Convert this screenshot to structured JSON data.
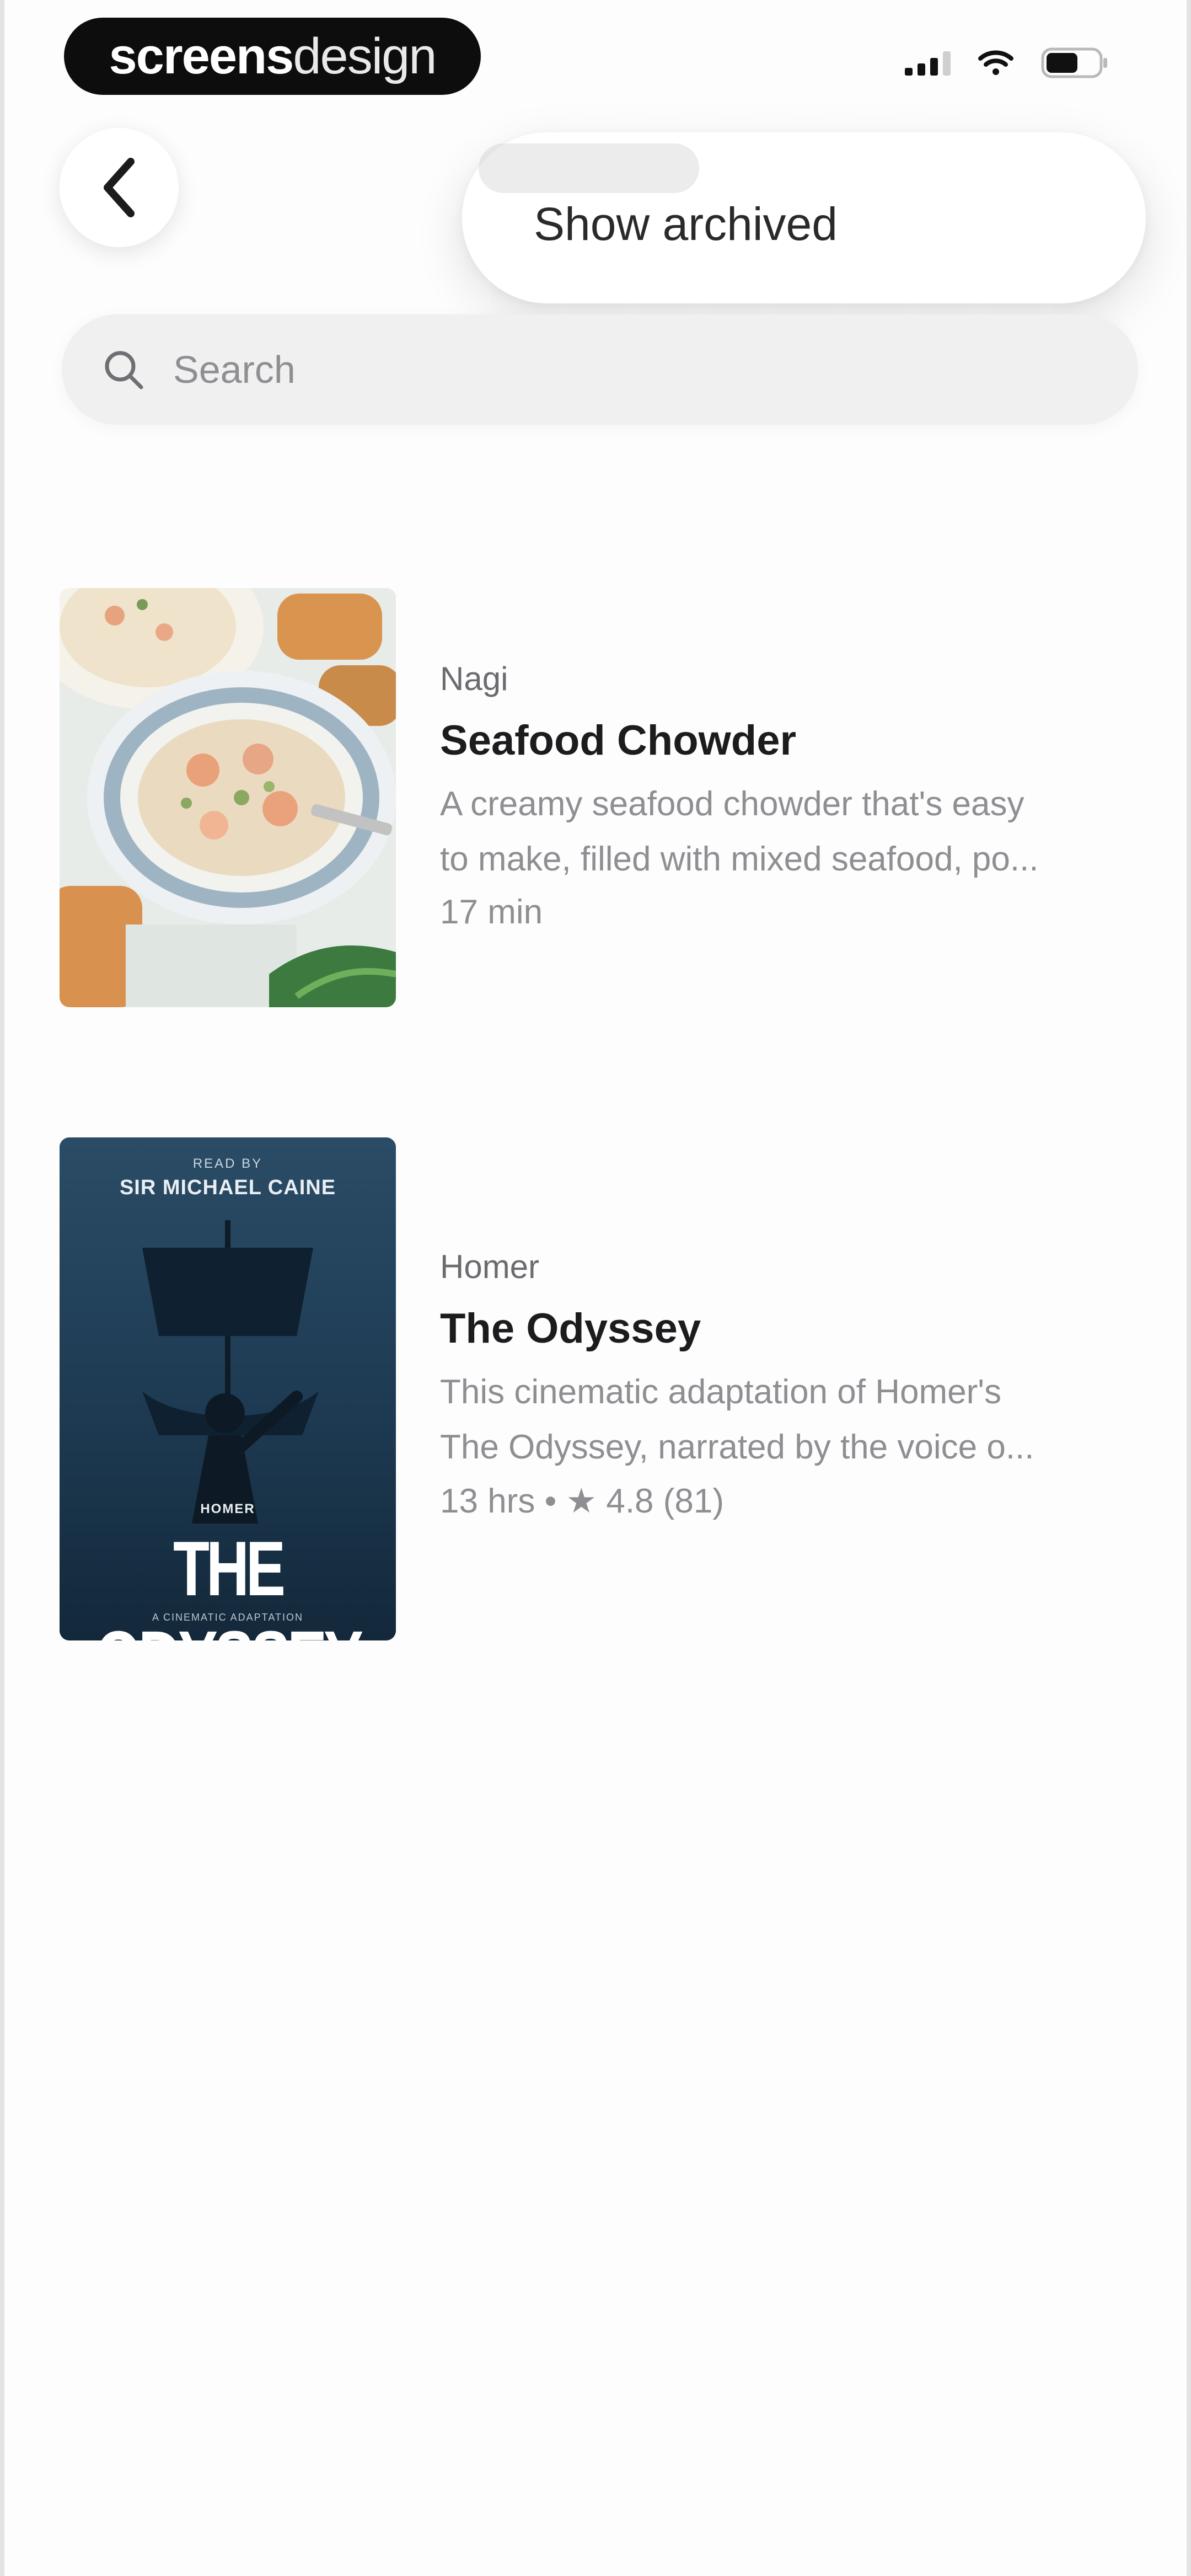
{
  "status_bar": {
    "brand_bold": "screens",
    "brand_light": "design"
  },
  "header": {
    "back_label": "Back",
    "menu_item_label": "Show archived"
  },
  "search": {
    "placeholder": "Search",
    "value": ""
  },
  "items": [
    {
      "author": "Nagi",
      "title": "Seafood Chowder",
      "description_line1": "A creamy seafood chowder that's easy",
      "description_line2": "to make, filled with mixed seafood, po...",
      "duration": "17 min"
    },
    {
      "author": "Homer",
      "title": "The Odyssey",
      "description_line1": "This cinematic adaptation of Homer's",
      "description_line2": "The Odyssey, narrated by the voice o...",
      "duration": "13 hrs",
      "separator": "•",
      "rating": "4.8",
      "rating_count": "(81)",
      "cover": {
        "narrated_by": "READ BY",
        "narrator": "SIR MICHAEL CAINE",
        "author_line": "HOMER",
        "title_line": "THE ODYSSEY",
        "subtitle": "A CINEMATIC ADAPTATION"
      }
    }
  ],
  "colors": {
    "background": "#fdfdfd",
    "search_bg": "#f0f0f1",
    "text_primary": "#1c1c1e",
    "text_secondary": "#8e8e93",
    "odyssey_cover": "#1f3a52"
  }
}
